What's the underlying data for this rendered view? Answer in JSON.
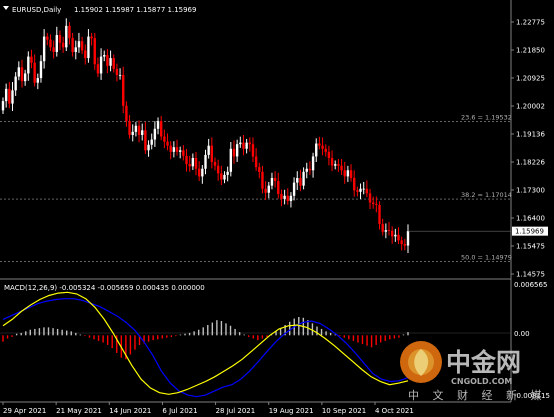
{
  "header": {
    "symbol": "EURUSD,Daily",
    "ohlc": "1.15902 1.15987 1.15877 1.15969"
  },
  "macd": {
    "label": "MACD(12,26,9) -0.005324 -0.005659 0.000435 0.000000"
  },
  "price_axis": {
    "ticks": [
      "1.22775",
      "1.21850",
      "1.20925",
      "1.20002",
      "1.19136",
      "1.18226",
      "1.17300",
      "1.16400",
      "1.15475",
      "1.14575"
    ],
    "current_price": "1.15969"
  },
  "macd_axis": {
    "ticks": [
      "0.006565",
      "0.00",
      "-0.008115"
    ]
  },
  "time_axis": {
    "labels": [
      "29 Apr 2021",
      "21 May 2021",
      "14 Jun 2021",
      "6 Jul 2021",
      "28 Jul 2021",
      "19 Aug 2021",
      "10 Sep 2021",
      "4 Oct 2021"
    ]
  },
  "fibonacci": [
    {
      "label": "23.6 = 1.19532",
      "price": 1.19532
    },
    {
      "label": "38.2 = 1.17014",
      "price": 1.17014
    },
    {
      "label": "50.0 = 1.14979",
      "price": 1.14979
    }
  ],
  "colors": {
    "background": "#000000",
    "bull": "#ffffff",
    "bear": "#ff0000",
    "histogram_pos": "#c0c0c0",
    "histogram_neg": "#ff0000",
    "macd_line": "#0000ff",
    "signal_line": "#ffff00",
    "grid": "#808080",
    "current_price_bg": "#ffffff"
  },
  "watermark": {
    "brand": "中金网",
    "domain": "CNGOLD.COM",
    "slogan": "中 文 财 经 新 媒 体"
  },
  "chart_data": [
    {
      "type": "candlestick",
      "title": "EURUSD,Daily",
      "ylim": [
        1.14575,
        1.22775
      ],
      "y_axis": "right",
      "x_start": "2021-04-29",
      "x_end": "2021-10-13",
      "series": [
        {
          "name": "EURUSD",
          "close": [
            1.202,
            1.206,
            1.2012,
            1.2055,
            1.21,
            1.213,
            1.2085,
            1.211,
            1.2165,
            1.2145,
            1.208,
            1.2095,
            1.215,
            1.223,
            1.222,
            1.2195,
            1.218,
            1.2235,
            1.221,
            1.2195,
            1.2265,
            1.2225,
            1.218,
            1.2195,
            1.2215,
            1.2185,
            1.216,
            1.223,
            1.2225,
            1.214,
            1.211,
            1.2165,
            1.217,
            1.2135,
            1.216,
            1.2125,
            1.2105,
            1.2105,
            1.2005,
            1.1955,
            1.191,
            1.192,
            1.194,
            1.191,
            1.1925,
            1.186,
            1.1878,
            1.1895,
            1.193,
            1.1955,
            1.1905,
            1.1888,
            1.1875,
            1.1855,
            1.187,
            1.1855,
            1.186,
            1.1842,
            1.1815,
            1.1808,
            1.1835,
            1.18,
            1.1775,
            1.18,
            1.1845,
            1.1875,
            1.1822,
            1.181,
            1.1785,
            1.1765,
            1.178,
            1.179,
            1.1865,
            1.184,
            1.188,
            1.1885,
            1.1865,
            1.1885,
            1.188,
            1.184,
            1.1805,
            1.179,
            1.1735,
            1.1722,
            1.1745,
            1.177,
            1.176,
            1.1718,
            1.1702,
            1.1712,
            1.1695,
            1.1712,
            1.1755,
            1.177,
            1.1745,
            1.179,
            1.18,
            1.1795,
            1.184,
            1.1882,
            1.1875,
            1.1865,
            1.1855,
            1.1835,
            1.181,
            1.1815,
            1.181,
            1.1795,
            1.1775,
            1.1795,
            1.177,
            1.173,
            1.1725,
            1.1735,
            1.1735,
            1.172,
            1.169,
            1.1685,
            1.1682,
            1.162,
            1.1595,
            1.16,
            1.1598,
            1.158,
            1.1585,
            1.1567,
            1.1555,
            1.155,
            1.1597
          ]
        }
      ]
    },
    {
      "type": "bar+line",
      "title": "MACD(12,26,9) -0.005324 -0.005659 0.000435 0.000000",
      "ylim": [
        -0.008115,
        0.006565
      ],
      "series": [
        {
          "name": "histogram",
          "values": [
            -0.0008,
            -0.0004,
            -0.0002,
            0.0002,
            0.0003,
            0.0005,
            0.0007,
            0.0008,
            0.0009,
            0.001,
            0.001,
            0.0009,
            0.0008,
            0.0007,
            0.0006,
            0.0005,
            0.0003,
            0.0001,
            -0.0001,
            -0.0003,
            -0.0005,
            -0.0007,
            -0.0009,
            -0.0012,
            -0.0016,
            -0.0022,
            -0.0028,
            -0.003,
            -0.0024,
            -0.0018,
            -0.0012,
            -0.001,
            -0.0008,
            -0.0006,
            -0.0005,
            -0.0004,
            -0.0003,
            -0.0002,
            -0.0001,
            0.0001,
            0.0002,
            0.0003,
            0.0005,
            0.0007,
            0.001,
            0.0013,
            0.0016,
            0.0019,
            0.0018,
            0.0015,
            0.0012,
            0.0008,
            0.0004,
            0.0001,
            -0.0002,
            -0.0004,
            -0.0006,
            -0.0004,
            -0.0002,
            0.0001,
            0.0005,
            0.0009,
            0.0013,
            0.0017,
            0.0021,
            0.0023,
            0.0022,
            0.0019,
            0.0015,
            0.0011,
            0.0008,
            0.0005,
            0.0003,
            0.0001,
            -0.0001,
            -0.0003,
            -0.0005,
            -0.0007,
            -0.0009,
            -0.0011,
            -0.0013,
            -0.0015,
            -0.0012,
            -0.0009,
            -0.0007,
            -0.0005,
            -0.0004,
            -0.0003,
            0.0001,
            0.0004
          ]
        },
        {
          "name": "MACD",
          "values": [
            0.002,
            0.0025,
            0.003,
            0.0035,
            0.004,
            0.0043,
            0.0045,
            0.0046,
            0.0046,
            0.0044,
            0.004,
            0.0036,
            0.003,
            0.0024,
            0.0016,
            0.0006,
            -0.0008,
            -0.0025,
            -0.0045,
            -0.006,
            -0.007,
            -0.0075,
            -0.0077,
            -0.0075,
            -0.007,
            -0.0065,
            -0.0062,
            -0.0055,
            -0.0045,
            -0.0033,
            -0.002,
            -0.0008,
            0.0002,
            0.001,
            0.0016,
            0.0018,
            0.0015,
            0.0008,
            0.0,
            -0.001,
            -0.0022,
            -0.0035,
            -0.0048,
            -0.0055,
            -0.0058,
            -0.0057,
            -0.0053
          ]
        },
        {
          "name": "Signal",
          "values": [
            0.0012,
            0.002,
            0.003,
            0.0038,
            0.0045,
            0.005,
            0.0053,
            0.0054,
            0.0052,
            0.0046,
            0.0035,
            0.002,
            0.0002,
            -0.0018,
            -0.0038,
            -0.0055,
            -0.0066,
            -0.0072,
            -0.0074,
            -0.0072,
            -0.0068,
            -0.0063,
            -0.0058,
            -0.0052,
            -0.0045,
            -0.0038,
            -0.003,
            -0.002,
            -0.001,
            0.0,
            0.0008,
            0.0012,
            0.0013,
            0.001,
            0.0004,
            -0.0004,
            -0.0013,
            -0.0023,
            -0.0033,
            -0.0043,
            -0.0052,
            -0.0058,
            -0.0062,
            -0.006,
            -0.0057
          ]
        }
      ]
    }
  ]
}
